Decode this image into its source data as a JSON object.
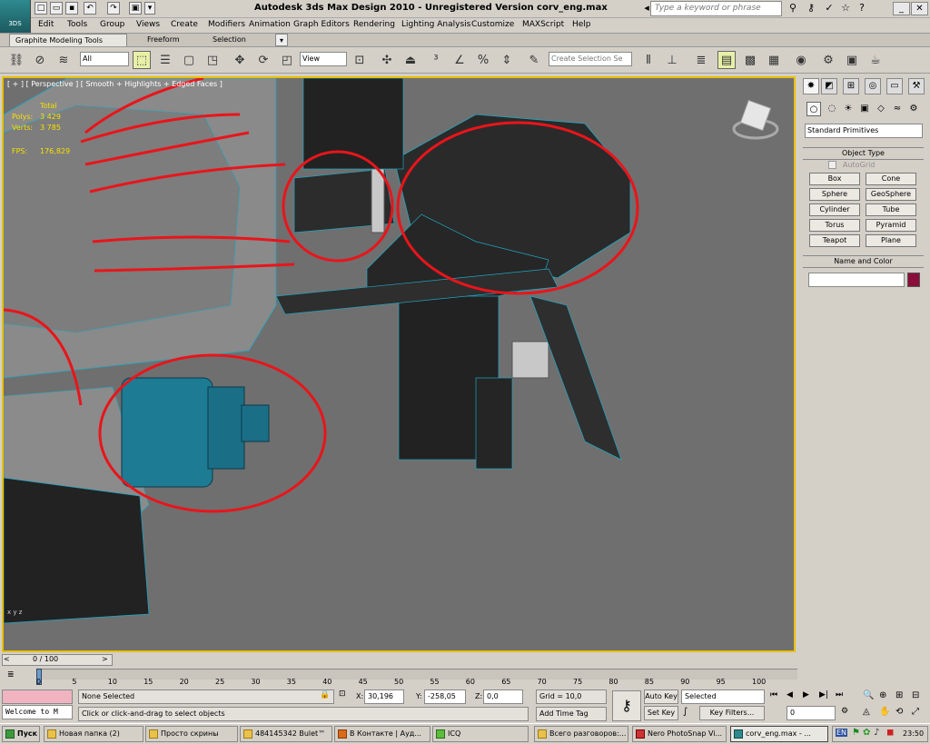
{
  "app": {
    "title": "Autodesk 3ds Max Design 2010   -   Unregistered Version     corv_eng.max",
    "logo_text": "3DS",
    "search_placeholder": "Type a keyword or phrase"
  },
  "menus": [
    "Edit",
    "Tools",
    "Group",
    "Views",
    "Create",
    "Modifiers",
    "Animation",
    "Graph Editors",
    "Rendering",
    "Lighting Analysis",
    "Customize",
    "MAXScript",
    "Help"
  ],
  "ribbon_tabs": [
    "Graphite Modeling Tools",
    "Freeform",
    "Selection"
  ],
  "toolbar": {
    "selection_filter": "All",
    "ref_coord": "View",
    "named_selection_placeholder": "Create Selection Se"
  },
  "viewport": {
    "label": "[ + ] [ Perspective ] [ Smooth + Highlights + Edged Faces ]",
    "stats": {
      "header": "Total",
      "polys_label": "Polys:",
      "polys_value": "3 429",
      "verts_label": "Verts:",
      "verts_value": "3 785",
      "fps_label": "FPS:",
      "fps_value": "176,829"
    },
    "axis_label": "x y z"
  },
  "command_panel": {
    "category": "Standard Primitives",
    "object_type_title": "Object Type",
    "autogrid_label": "AutoGrid",
    "buttons": [
      "Box",
      "Cone",
      "Sphere",
      "GeoSphere",
      "Cylinder",
      "Tube",
      "Torus",
      "Pyramid",
      "Teapot",
      "Plane"
    ],
    "name_color_title": "Name and Color",
    "object_color": "#8b0e3a"
  },
  "timeline": {
    "frame_indicator": "0 / 100",
    "ticks": [
      "0",
      "5",
      "10",
      "15",
      "20",
      "25",
      "30",
      "35",
      "40",
      "45",
      "50",
      "55",
      "60",
      "65",
      "70",
      "75",
      "80",
      "85",
      "90",
      "95",
      "100"
    ]
  },
  "status": {
    "maxscript_listener": "Welcome to M",
    "selection_status": "None Selected",
    "prompt": "Click or click-and-drag to select objects",
    "x_label": "X:",
    "x_value": "30,196",
    "y_label": "Y:",
    "y_value": "-258,05",
    "z_label": "Z:",
    "z_value": "0,0",
    "grid": "Grid = 10,0",
    "add_time_tag": "Add Time Tag",
    "auto_key": "Auto Key",
    "set_key": "Set Key",
    "key_mode": "Selected",
    "key_filters": "Key Filters...",
    "current_frame": "0"
  },
  "taskbar": {
    "start": "Пуск",
    "tasks": [
      "Новая папка (2)",
      "Просто скрины",
      "484145342 Bulet™",
      "В Контакте | Ауд...",
      "ICQ",
      "Всего разговоров:...",
      "Nero PhotoSnap Vi...",
      "corv_eng.max - ..."
    ],
    "clock": "23:50"
  },
  "colors": {
    "annotation_red": "#e8151b",
    "wire_cyan": "#1fa6c2",
    "viewport_bg": "#6f6f6f",
    "stat_yellow": "#f6e000"
  }
}
